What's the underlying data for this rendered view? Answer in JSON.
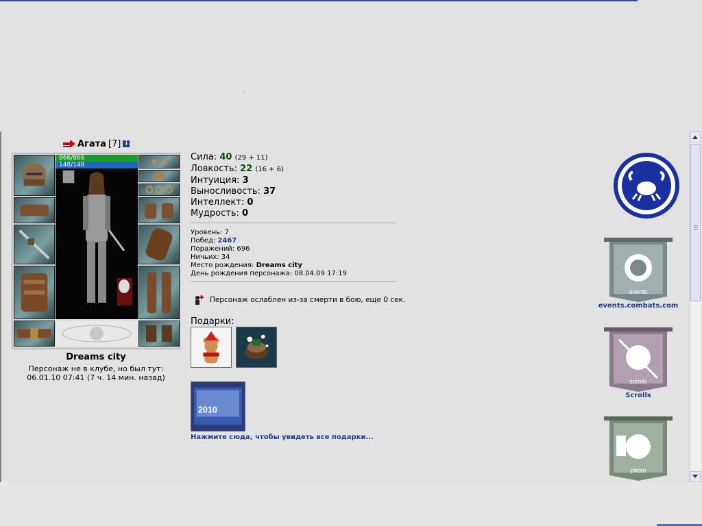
{
  "character": {
    "name": "Агата",
    "level_tag": "[7]",
    "hp": "866/866",
    "mana": "148/148",
    "city": "Dreams city",
    "offline_line1": "Персонаж не в клубе, но был тут:",
    "offline_line2": "06.01.10 07:41 (7 ч. 14 мин. назад)"
  },
  "stats": {
    "strength_label": "Сила:",
    "strength_value": "40",
    "strength_detail": "(29 + 11)",
    "agility_label": "Ловкость:",
    "agility_value": "22",
    "agility_detail": "(16 + 6)",
    "intuition_label": "Интуиция:",
    "intuition_value": "3",
    "endurance_label": "Выносливость:",
    "endurance_value": "37",
    "intellect_label": "Интеллект:",
    "intellect_value": "0",
    "wisdom_label": "Мудрость:",
    "wisdom_value": "0"
  },
  "info": {
    "level_label": "Уровень:",
    "level_value": "7",
    "wins_label": "Побед:",
    "wins_value": "2467",
    "losses_label": "Поражений:",
    "losses_value": "696",
    "draws_label": "Ничьих:",
    "draws_value": "34",
    "birthplace_label": "Место рождения:",
    "birthplace_value": "Dreams city",
    "birthday_label": "День рождения персонажа:",
    "birthday_value": "08.04.09 17:19"
  },
  "status_text": "Персонаж ослаблен из-за смерти в бою, еще 0 сек.",
  "gifts": {
    "label": "Подарки:",
    "link": "Нажмите сюда, чтобы увидеть все подарки...",
    "card_year": "2010"
  },
  "sidebar": {
    "events_label": "events.combats.com",
    "scrolls_label": "Scrolls",
    "banner_events_text": "events",
    "banner_scrolls_text": "scrolls",
    "banner_photo_text": "photo"
  },
  "colors": {
    "stat_value": "#0a4a0a",
    "link": "#1a3a8a",
    "hp": "#1a9a2a",
    "mana": "#1c6ab8"
  },
  "icons": [
    "arrow-right-icon",
    "info-icon",
    "weakness-icon",
    "clan-emblem-icon",
    "scroll-up-icon",
    "scroll-down-icon"
  ]
}
